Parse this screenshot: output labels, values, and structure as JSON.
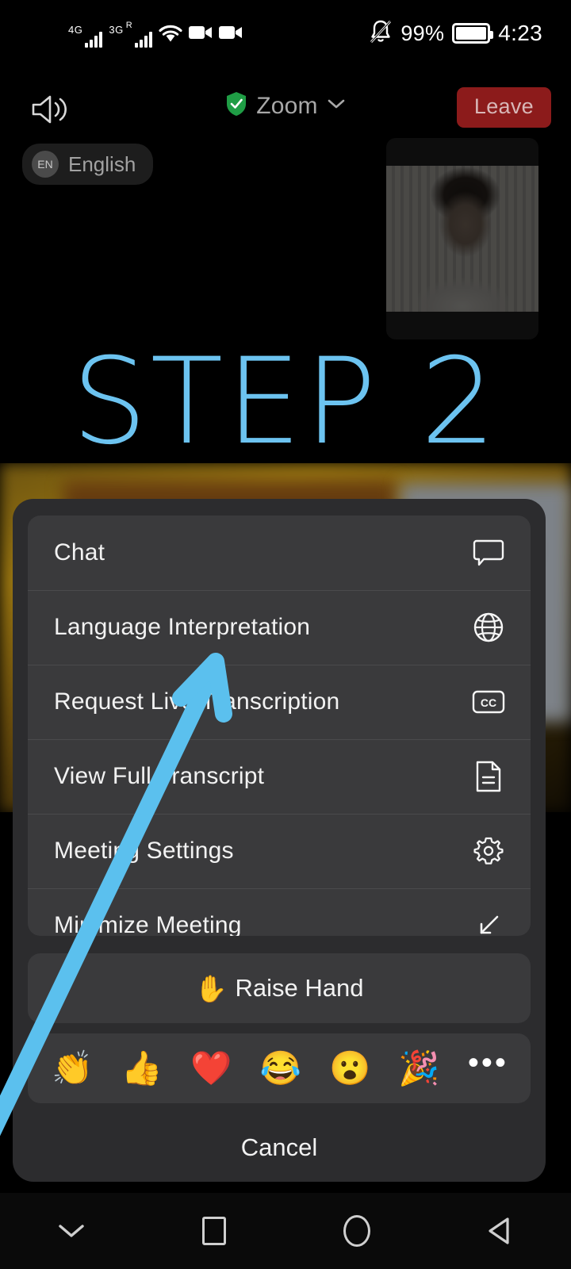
{
  "status_bar": {
    "network_1": "4G",
    "network_2": "3G",
    "roaming": "R",
    "battery_percent": "99%",
    "time": "4:23",
    "icons": [
      "signal-bars-icon",
      "wifi-icon",
      "video-record-icon",
      "video-camera-icon",
      "bell-muted-icon",
      "battery-icon"
    ]
  },
  "meeting_bar": {
    "speaker_icon": "speaker-icon",
    "title": "Zoom",
    "shield_icon": "green-shield-icon",
    "chevron_icon": "chevron-down-icon",
    "leave_label": "Leave"
  },
  "language_pill": {
    "avatar": "EN",
    "label": "English"
  },
  "overlay": {
    "step_text": "STEP 2",
    "step_color": "#6cc3f0",
    "arrow_color": "#5bc0ee",
    "arrow_points_to": "Language Interpretation"
  },
  "self_view": {
    "label": "self-video-thumbnail"
  },
  "action_sheet": {
    "menu_items": [
      {
        "label": "Chat",
        "icon": "chat-bubble-icon"
      },
      {
        "label": "Language Interpretation",
        "icon": "globe-icon"
      },
      {
        "label": "Request Live Transcription",
        "icon": "cc-icon"
      },
      {
        "label": "View Full Transcript",
        "icon": "document-icon"
      },
      {
        "label": "Meeting Settings",
        "icon": "gear-icon"
      },
      {
        "label": "Minimize Meeting",
        "icon": "minimize-arrow-icon"
      }
    ],
    "raise_hand": {
      "emoji": "✋",
      "label": "Raise Hand"
    },
    "reactions": [
      {
        "emoji": "👏",
        "name": "clap-reaction"
      },
      {
        "emoji": "👍",
        "name": "thumbs-up-reaction"
      },
      {
        "emoji": "❤️",
        "name": "heart-reaction"
      },
      {
        "emoji": "😂",
        "name": "joy-reaction"
      },
      {
        "emoji": "😮",
        "name": "surprised-reaction"
      },
      {
        "emoji": "🎉",
        "name": "party-popper-reaction"
      }
    ],
    "more_reactions": "•••",
    "cancel_label": "Cancel"
  },
  "nav_bar": {
    "items": [
      {
        "name": "hide-keyboard-icon"
      },
      {
        "name": "recents-square-icon"
      },
      {
        "name": "home-circle-icon"
      },
      {
        "name": "back-triangle-icon"
      }
    ]
  }
}
